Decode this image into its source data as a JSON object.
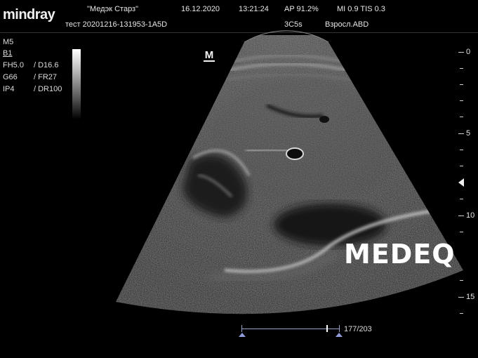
{
  "header": {
    "brand": "mindray",
    "institution": "\"Медэк Старз\"",
    "date": "16.12.2020",
    "time": "13:21:24",
    "ap": "AP 91.2%",
    "mi_tis": "MI 0.9 TIS 0.3",
    "patient": "тест 20201216-131953-1A5D",
    "probe": "3C5s",
    "preset": "Взросл.ABD"
  },
  "params": {
    "mode": "M5",
    "layout": "B1",
    "fh": "FH5.0",
    "depth": "/ D16.6",
    "gain": "G66",
    "fr": "/ FR27",
    "ip": "IP4",
    "dr": "/ DR100"
  },
  "orientation_marker": "M",
  "depth_scale": [
    "0",
    "5",
    "10",
    "15"
  ],
  "watermark": "MEDEQ",
  "cine": {
    "frame": "177/203",
    "position": 0.87
  }
}
